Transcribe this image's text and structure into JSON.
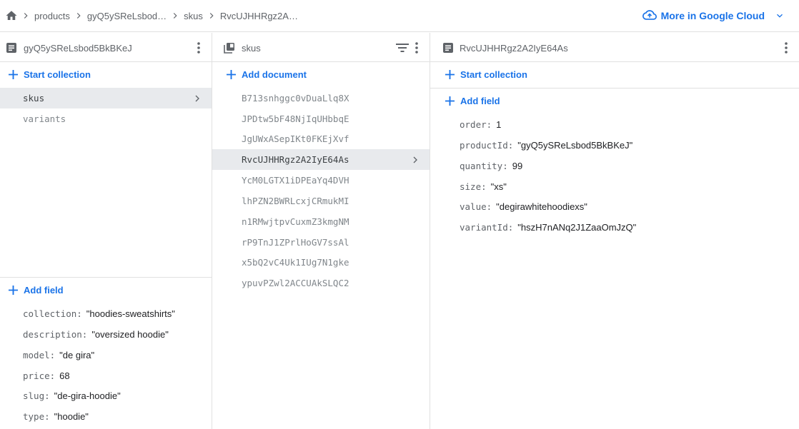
{
  "breadcrumb": {
    "items": [
      "products",
      "gyQ5ySReLsbod…",
      "skus",
      "RvcUJHHRgz2A…"
    ]
  },
  "cloud_link": {
    "label": "More in Google Cloud"
  },
  "panel1": {
    "title": "gyQ5ySReLsbod5BkBKeJ",
    "start_collection": "Start collection",
    "collections": [
      "skus",
      "variants"
    ],
    "add_field": "Add field",
    "fields": [
      {
        "key": "collection:",
        "value": "\"hoodies-sweatshirts\""
      },
      {
        "key": "description:",
        "value": "\"oversized hoodie\""
      },
      {
        "key": "model:",
        "value": "\"de gira\""
      },
      {
        "key": "price:",
        "value": "68"
      },
      {
        "key": "slug:",
        "value": "\"de-gira-hoodie\""
      },
      {
        "key": "type:",
        "value": "\"hoodie\""
      }
    ]
  },
  "panel2": {
    "title": "skus",
    "add_document": "Add document",
    "documents": [
      "B713snhggc0vDuaLlq8X",
      "JPDtw5bF48NjIqUHbbqE",
      "JgUWxASepIKt0FKEjXvf",
      "RvcUJHHRgz2A2IyE64As",
      "YcM0LGTX1iDPEaYq4DVH",
      "lhPZN2BWRLcxjCRmukMI",
      "n1RMwjtpvCuxmZ3kmgNM",
      "rP9TnJ1ZPrlHoGV7ssAl",
      "x5bQ2vC4Uk1IUg7N1gke",
      "ypuvPZwl2ACCUAkSLQC2"
    ]
  },
  "panel3": {
    "title": "RvcUJHHRgz2A2IyE64As",
    "start_collection": "Start collection",
    "add_field": "Add field",
    "fields": [
      {
        "key": "order:",
        "value": "1"
      },
      {
        "key": "productId:",
        "value": "\"gyQ5ySReLsbod5BkBKeJ\""
      },
      {
        "key": "quantity:",
        "value": "99"
      },
      {
        "key": "size:",
        "value": "\"xs\""
      },
      {
        "key": "value:",
        "value": "\"degirawhitehoodiexs\""
      },
      {
        "key": "variantId:",
        "value": "\"hszH7nANq2J1ZaaOmJzQ\""
      }
    ]
  },
  "colors": {
    "accent": "#1a73e8",
    "selected_bg": "#e8eaed",
    "border": "#e0e0e0"
  }
}
